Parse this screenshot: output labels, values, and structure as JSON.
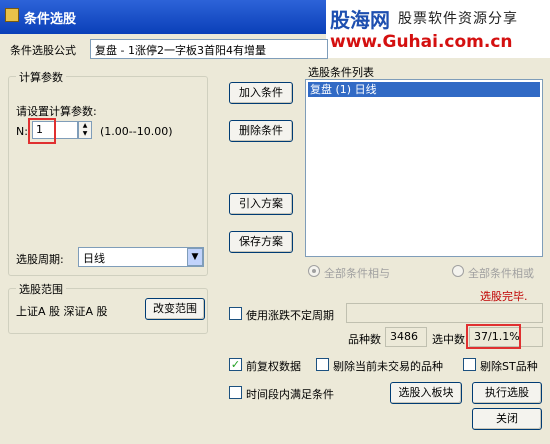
{
  "window": {
    "title": "条件选股"
  },
  "watermark": {
    "logo": "股海网",
    "slogan": "股票软件资源分享",
    "url": "www.Guhai.com.cn"
  },
  "formula": {
    "label": "条件选股公式",
    "value": "复盘             - 1涨停2一字板3首阳4有增量"
  },
  "params": {
    "group_title": "计算参数",
    "prompt": "请设置计算参数:",
    "n_label": "N:",
    "n_value": "1",
    "n_range": "(1.00--10.00)"
  },
  "period": {
    "label": "选股周期:",
    "value": "日线"
  },
  "scope": {
    "group_title": "选股范围",
    "value": "上证A 股 深证A 股",
    "change_button": "改变范围"
  },
  "buttons": {
    "add": "加入条件",
    "delete": "删除条件",
    "import": "引入方案",
    "save": "保存方案",
    "to_block": "选股入板块",
    "execute": "执行选股",
    "close": "关闭"
  },
  "condition_list": {
    "label": "选股条件列表",
    "items": [
      "复盘 (1) 日线"
    ]
  },
  "logic": {
    "and_label": "全部条件相与",
    "or_label": "全部条件相或"
  },
  "status": {
    "text": "选股完毕."
  },
  "options": {
    "uncertain_period": "使用涨跌不定周期",
    "restore_rights": "前复权数据",
    "exclude_no_trade": "剔除当前未交易的品种",
    "exclude_st": "剔除ST品种",
    "time_range": "时间段内满足条件"
  },
  "stats": {
    "count_label": "品种数",
    "count_value": "3486",
    "selected_label": "选中数",
    "selected_value": "37/1.1%"
  },
  "colors": {
    "title_bar": "#0a3fb8",
    "selection": "#316ac5",
    "status": "#c00000",
    "highlight_box": "#e03030"
  }
}
